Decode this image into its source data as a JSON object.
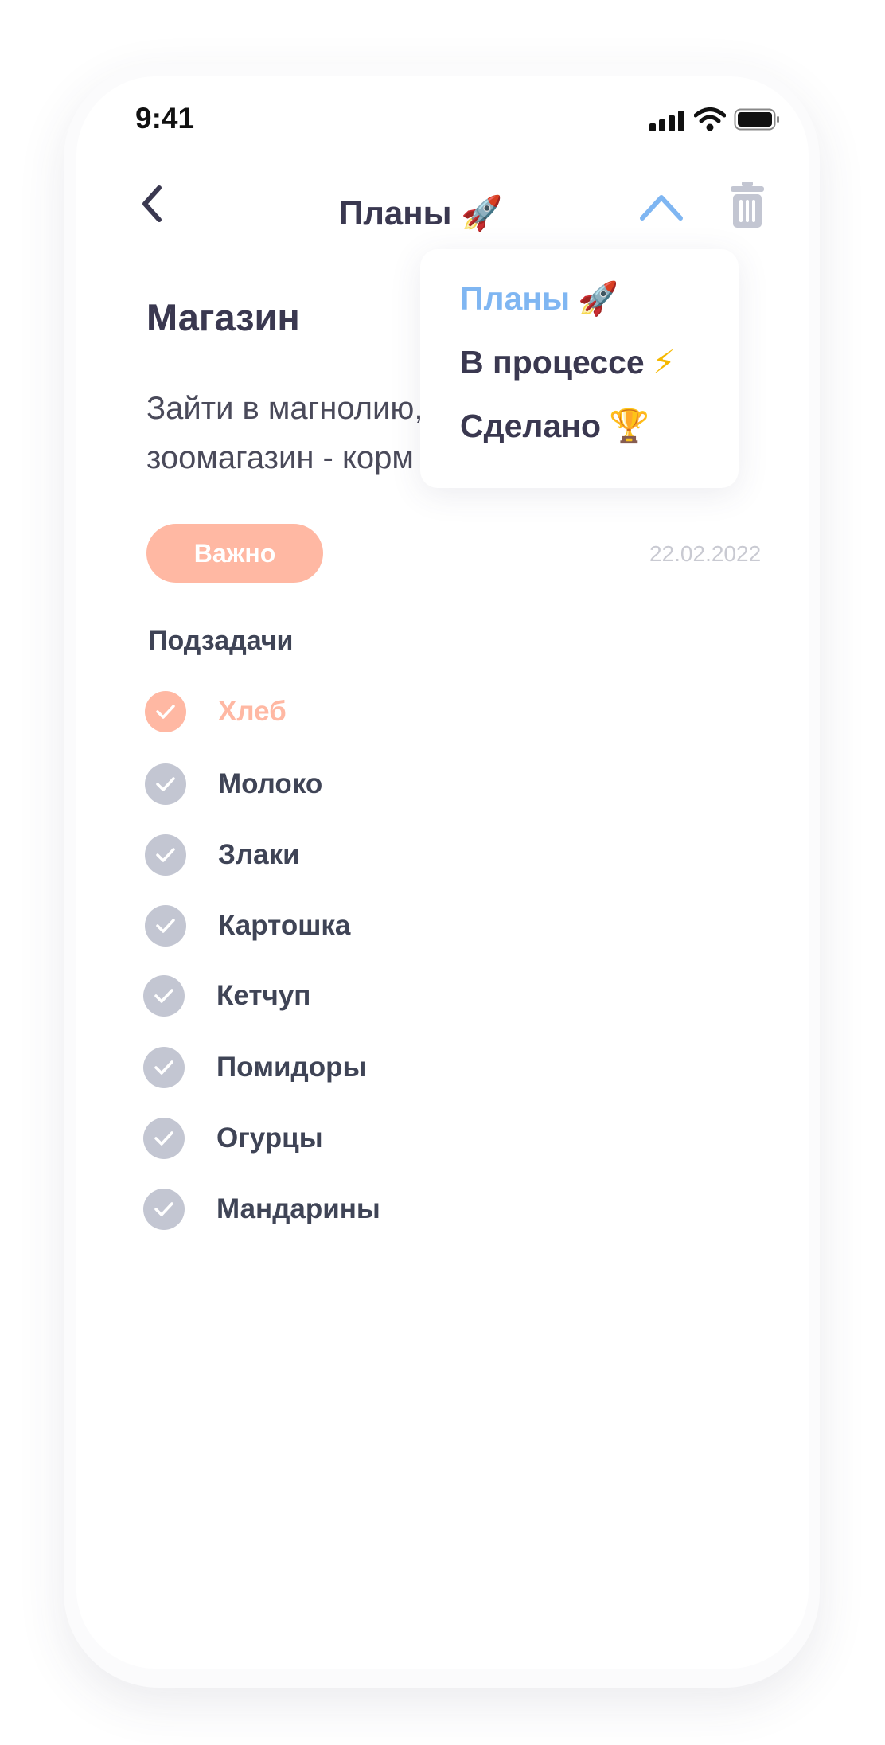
{
  "status_bar": {
    "time": "9:41",
    "icons": [
      "signal-icon",
      "wifi-icon",
      "battery-icon"
    ]
  },
  "header": {
    "title": "Планы 🚀",
    "back_icon": "chevron-left-icon",
    "collapse_icon": "chevron-up-icon",
    "delete_icon": "trash-icon"
  },
  "dropdown": {
    "items": [
      {
        "label": "Планы",
        "emoji": "🚀",
        "active": true
      },
      {
        "label": "В процессе",
        "emoji": "⚡",
        "active": false
      },
      {
        "label": "Сделано",
        "emoji": "🏆",
        "active": false
      }
    ]
  },
  "task": {
    "title": "Магазин",
    "description_line1": "Зайти в магнолию,",
    "description_line2": "зоомагазин - корм",
    "badge": "Важно",
    "date": "22.02.2022"
  },
  "subtasks": {
    "heading": "Подзадачи",
    "items": [
      {
        "label": "Хлеб",
        "highlighted": true
      },
      {
        "label": "Молоко",
        "highlighted": false
      },
      {
        "label": "Злаки",
        "highlighted": false
      },
      {
        "label": "Картошка",
        "highlighted": false
      },
      {
        "label": "Кетчуп",
        "highlighted": false
      },
      {
        "label": "Помидоры",
        "highlighted": false
      },
      {
        "label": "Огурцы",
        "highlighted": false
      },
      {
        "label": "Мандарины",
        "highlighted": false
      }
    ]
  },
  "colors": {
    "accent_blue": "#7fb6f2",
    "accent_peach": "#ffb8a3",
    "text_dark": "#3a3850",
    "check_gray": "#c3c6d2"
  }
}
